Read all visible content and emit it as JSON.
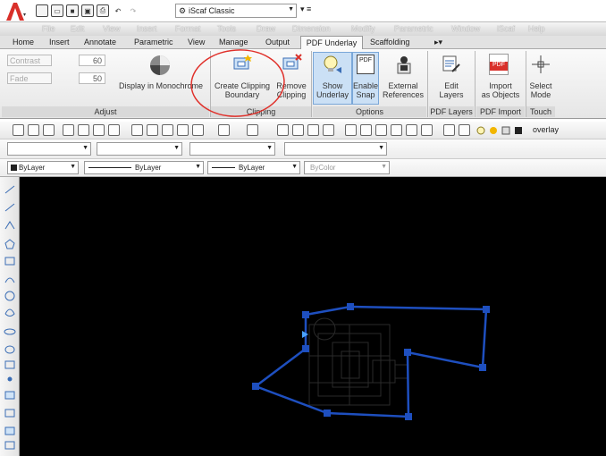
{
  "titlebar": {
    "app_logo": "A",
    "workspace_label": "iScaf Classic",
    "workspace_extra": "▾ ≡"
  },
  "menu": [
    "File",
    "Edit",
    "View",
    "Insert",
    "Format",
    "Tools",
    "Draw",
    "Dimension",
    "Modify",
    "Parametric",
    "Window",
    "iScaf",
    "Help"
  ],
  "ribbon_tabs": [
    "Home",
    "Insert",
    "Annotate",
    "Parametric",
    "View",
    "Manage",
    "Output",
    "PDF Underlay",
    "Scaffolding"
  ],
  "ribbon_tabs_extra": "▸▾",
  "ribbon": {
    "adjust": {
      "contrast_label": "Contrast",
      "contrast_value": "60",
      "fade_label": "Fade",
      "fade_value": "50",
      "monochrome_label": "Display in Monochrome",
      "title": "Adjust"
    },
    "clipping": {
      "create_label_1": "Create Clipping",
      "create_label_2": "Boundary",
      "remove_label_1": "Remove",
      "remove_label_2": "Clipping",
      "title": "Clipping"
    },
    "options": {
      "show_label_1": "Show",
      "show_label_2": "Underlay",
      "snap_label_1": "Enable",
      "snap_label_2": "Snap",
      "external_label_1": "External",
      "external_label_2": "References",
      "snap_icon_text": "PDF",
      "title": "Options"
    },
    "pdf_layers": {
      "edit_label_1": "Edit",
      "edit_label_2": "Layers",
      "title": "PDF Layers"
    },
    "pdf_import": {
      "import_label_1": "Import",
      "import_label_2": "as Objects",
      "import_icon_text": "PDF",
      "title": "PDF Import"
    },
    "touch": {
      "select_label_1": "Select",
      "select_label_2": "Mode",
      "title": "Touch"
    }
  },
  "toolbar": {
    "layer_name": "overlay",
    "bylayer_color": "ByLayer",
    "bylayer_linetype": "ByLayer",
    "bylayer_lineweight": "ByLayer",
    "bycolor": "ByColor"
  },
  "colors": {
    "accent_red": "#d9302a",
    "annotation_circle": "#e0302a",
    "boundary_blue": "#1e4fbf",
    "drawing_bg": "#000000"
  }
}
